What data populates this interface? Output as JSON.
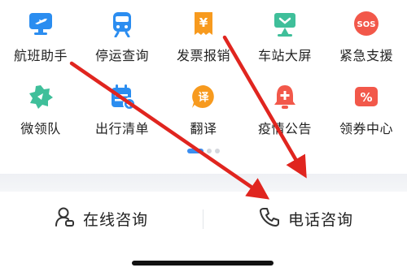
{
  "services": {
    "row1": [
      {
        "label": "航班助手",
        "icon": "flight-icon",
        "color": "#2b8df0"
      },
      {
        "label": "停运查询",
        "icon": "train-icon",
        "color": "#2b8df0"
      },
      {
        "label": "发票报销",
        "icon": "invoice-yen-icon",
        "color": "#f79a1e"
      },
      {
        "label": "车站大屏",
        "icon": "station-screen-icon",
        "color": "#3fbf9a"
      },
      {
        "label": "紧急支援",
        "icon": "sos-icon",
        "color": "#f2584a"
      }
    ],
    "row2": [
      {
        "label": "微领队",
        "icon": "team-leader-icon",
        "color": "#3fbf9a"
      },
      {
        "label": "出行清单",
        "icon": "calendar-check-icon",
        "color": "#2b8df0"
      },
      {
        "label": "翻译",
        "icon": "translate-icon",
        "color": "#f79a1e"
      },
      {
        "label": "疫情公告",
        "icon": "bell-plus-icon",
        "color": "#f2584a"
      },
      {
        "label": "领券中心",
        "icon": "coupon-percent-icon",
        "color": "#f2584a"
      }
    ],
    "sos_text": "SOS",
    "yen_text": "¥",
    "translate_text": "译",
    "percent_text": "%"
  },
  "pager": {
    "pages": 3,
    "active_index": 0
  },
  "consult_bar": {
    "online_label": "在线咨询",
    "online_icon": "customer-service-icon",
    "phone_label": "电话咨询",
    "phone_icon": "phone-icon"
  },
  "colors": {
    "accent_blue": "#2b8df0",
    "annotation_arrow": "#e0251f"
  }
}
